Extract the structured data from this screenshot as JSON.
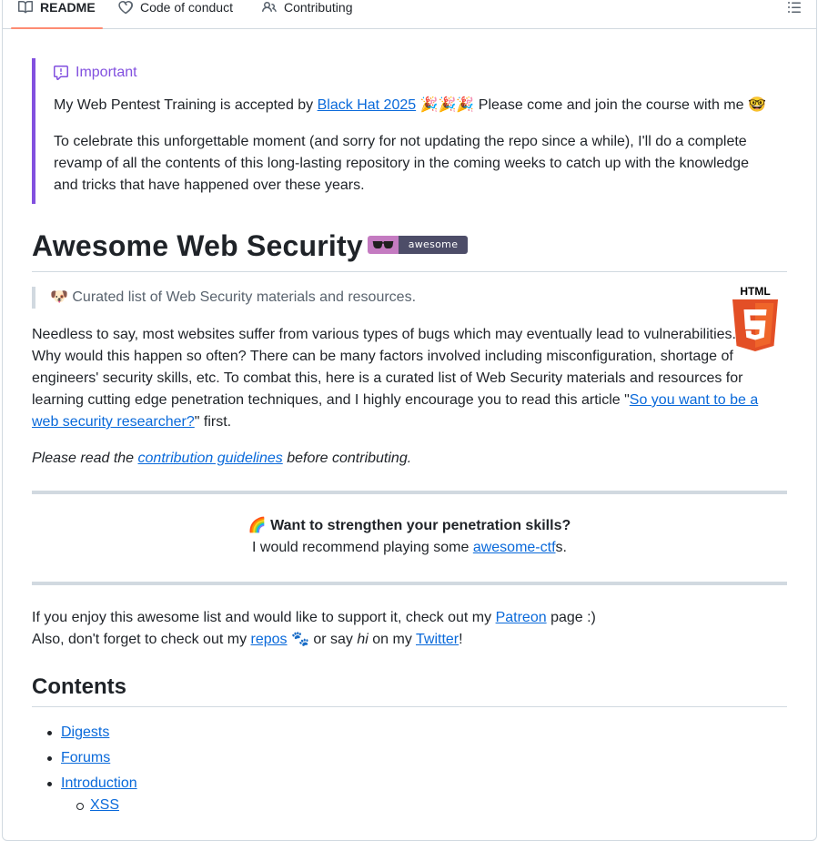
{
  "tabs": [
    {
      "label": "README",
      "icon": "book-icon",
      "active": true
    },
    {
      "label": "Code of conduct",
      "icon": "code-of-conduct-icon",
      "active": false
    },
    {
      "label": "Contributing",
      "icon": "people-icon",
      "active": false
    }
  ],
  "outline_icon": "list-unordered-icon",
  "alert": {
    "title": "Important",
    "icon": "report-icon",
    "color": "#8250df",
    "p1_before": "My Web Pentest Training is accepted by ",
    "p1_link": "Black Hat 2025",
    "p1_after": " 🎉🎉🎉 Please come and join the course with me 🤓",
    "p2": "To celebrate this unforgettable moment (and sorry for not updating the repo since a while), I'll do a complete revamp of all the contents of this long-lasting repository in the coming weeks to catch up with the knowledge and tricks that have happened over these years."
  },
  "heading": {
    "title": "Awesome Web Security",
    "badge_text": "awesome",
    "badge_colors": {
      "left": "#c47bc1",
      "right": "#4d4d68"
    }
  },
  "quote": "🐶 Curated list of Web Security materials and resources.",
  "html5_logo_text": "HTML",
  "intro": {
    "text_before": "Needless to say, most websites suffer from various types of bugs which may eventually lead to vulnerabilities. Why would this happen so often? There can be many factors involved including misconfiguration, shortage of engineers' security skills, etc. To combat this, here is a curated list of Web Security materials and resources for learning cutting edge penetration techniques, and I highly encourage you to read this article \"",
    "link": "So you want to be a web security researcher?",
    "text_after": "\" first."
  },
  "contrib": {
    "before": "Please read the ",
    "link": "contribution guidelines",
    "after": " before contributing."
  },
  "callout": {
    "heading": "🌈 Want to strengthen your penetration skills?",
    "line_before": "I would recommend playing some ",
    "link": "awesome-ctf",
    "line_after": "s."
  },
  "support": {
    "l1_before": "If you enjoy this awesome list and would like to support it, check out my ",
    "l1_link": "Patreon",
    "l1_after": " page :)",
    "l2_before": "Also, don't forget to check out my ",
    "l2_link1": "repos",
    "l2_mid1": " 🐾 or say ",
    "l2_em": "hi",
    "l2_mid2": " on my ",
    "l2_link2": "Twitter",
    "l2_after": "!"
  },
  "contents": {
    "title": "Contents",
    "items": [
      "Digests",
      "Forums",
      "Introduction"
    ],
    "subitems": [
      "XSS"
    ]
  },
  "colors": {
    "link": "#0969da",
    "tab_underline": "#fd8c73",
    "border": "#d1d9e0"
  }
}
